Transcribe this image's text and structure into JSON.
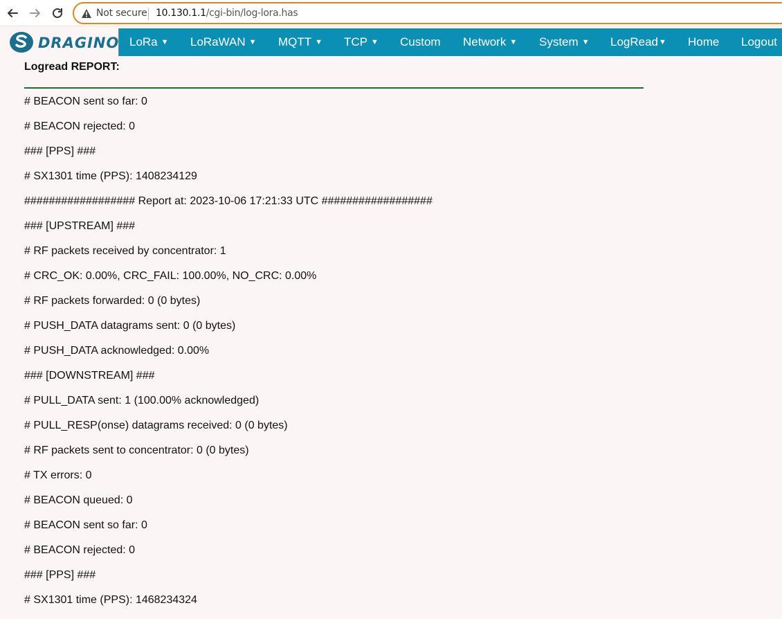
{
  "browser": {
    "security_label": "Not secure",
    "url_host": "10.130.1.1",
    "url_path": "/cgi-bin/log-lora.has"
  },
  "brand": {
    "name": "DRAGINO",
    "color": "#1c6e8f"
  },
  "nav": {
    "items": [
      {
        "label": "LoRa",
        "dropdown": true
      },
      {
        "label": "LoRaWAN",
        "dropdown": true
      },
      {
        "label": "MQTT",
        "dropdown": true
      },
      {
        "label": "TCP",
        "dropdown": true
      },
      {
        "label": "Custom",
        "dropdown": false
      },
      {
        "label": "Network",
        "dropdown": true
      },
      {
        "label": "System",
        "dropdown": true
      },
      {
        "label": "LogRead",
        "dropdown": true
      },
      {
        "label": "Home",
        "dropdown": false
      },
      {
        "label": "Logout",
        "dropdown": false
      }
    ],
    "color": "#0b8fb3"
  },
  "report": {
    "title": "Logread REPORT:",
    "lines": [
      "# BEACON sent so far: 0",
      "# BEACON rejected: 0",
      "### [PPS] ###",
      "# SX1301 time (PPS): 1408234129",
      "################## Report at: 2023-10-06 17:21:33 UTC ##################",
      "### [UPSTREAM] ###",
      "# RF packets received by concentrator: 1",
      "# CRC_OK: 0.00%, CRC_FAIL: 100.00%, NO_CRC: 0.00%",
      "# RF packets forwarded: 0 (0 bytes)",
      "# PUSH_DATA datagrams sent: 0 (0 bytes)",
      "# PUSH_DATA acknowledged: 0.00%",
      "### [DOWNSTREAM] ###",
      "# PULL_DATA sent: 1 (100.00% acknowledged)",
      "# PULL_RESP(onse) datagrams received: 0 (0 bytes)",
      "# RF packets sent to concentrator: 0 (0 bytes)",
      "# TX errors: 0",
      "# BEACON queued: 0",
      "# BEACON sent so far: 0",
      "# BEACON rejected: 0",
      "### [PPS] ###",
      "# SX1301 time (PPS): 1468234324"
    ]
  }
}
